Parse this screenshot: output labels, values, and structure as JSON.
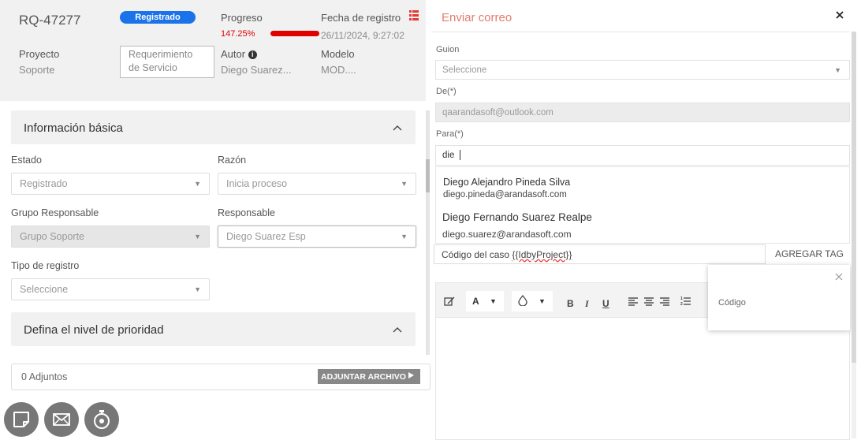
{
  "header": {
    "case_id": "RQ-47277",
    "status_badge": "Registrado",
    "progress_label": "Progreso",
    "progress_value": "147.25%",
    "progress_fraction": 1.0,
    "date_label": "Fecha de registro",
    "date_value": "26/11/2024, 9:27:02",
    "project_label": "Proyecto",
    "project_value": "Soporte",
    "type_line1": "Requerimiento",
    "type_line2": "de Servicio",
    "author_label": "Autor",
    "author_value": "Diego Suarez...",
    "model_label": "Modelo",
    "model_value": "MOD...."
  },
  "basic_info": {
    "title": "Información básica",
    "state_label": "Estado",
    "state_value": "Registrado",
    "reason_label": "Razón",
    "reason_value": "Inicia proceso",
    "group_label": "Grupo Responsable",
    "group_value": "Grupo Soporte",
    "owner_label": "Responsable",
    "owner_value": "Diego Suarez Esp",
    "record_type_label": "Tipo de registro",
    "record_type_value": "Seleccione"
  },
  "priority": {
    "title": "Defina el nivel de prioridad"
  },
  "attachments": {
    "count_label": "0 Adjuntos",
    "button_label": "ADJUNTAR ARCHIVO"
  },
  "email": {
    "title": "Enviar correo",
    "script_label": "Guion",
    "script_value": "Seleccione",
    "from_label": "De(*)",
    "from_value": "qaarandasoft@outlook.com",
    "to_label": "Para(*)",
    "to_value": "die",
    "suggestions": [
      {
        "name": "Diego Alejandro Pineda Silva",
        "email": "diego.pineda@arandasoft.com"
      },
      {
        "name": "Diego Fernando Suarez Realpe",
        "email": "diego.suarez@arandasoft.com"
      }
    ],
    "subject_prefix": "Código del caso ",
    "subject_tag": "{{IdbyProject}}",
    "add_tag_label": "AGREGAR TAG",
    "popup_item": "Código",
    "toolbar": {
      "font_color": "A",
      "bold": "B",
      "italic": "I",
      "underline": "U"
    }
  },
  "colors": {
    "accent": "#1a73e8",
    "title_red": "#e07d6e",
    "progress_red": "#e00000"
  }
}
